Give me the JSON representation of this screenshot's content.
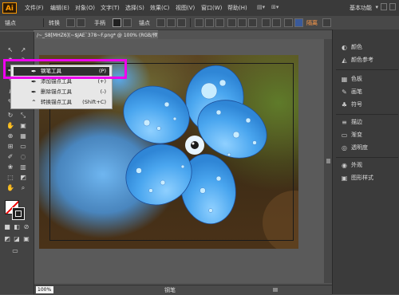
{
  "app": {
    "logo": "Ai"
  },
  "menubar": {
    "items": [
      "文件(F)",
      "编辑(E)",
      "对象(O)",
      "文字(T)",
      "选择(S)",
      "效果(C)",
      "视图(V)",
      "窗口(W)",
      "帮助(H)"
    ],
    "workspace": "基本功能"
  },
  "controlbar": {
    "anchor_label": "锚点",
    "convert_label": "转换",
    "handle_label": "手柄",
    "anchors_label": "锚点",
    "isolate_label": "隔离"
  },
  "document": {
    "tab_title": "/~_S8[MHZ6](~$JAE`378~F.png* @ 100% (RGB/预览)",
    "zoom": "100%",
    "status_tool": "钢笔"
  },
  "flyout": {
    "items": [
      {
        "icon": "pen-icon",
        "label": "钢笔工具",
        "shortcut": "(P)",
        "selected": true
      },
      {
        "icon": "add-anchor-icon",
        "label": "添加锚点工具",
        "shortcut": "(+)",
        "selected": false
      },
      {
        "icon": "delete-anchor-icon",
        "label": "删除锚点工具",
        "shortcut": "(-)",
        "selected": false
      },
      {
        "icon": "convert-anchor-icon",
        "label": "转换锚点工具",
        "shortcut": "(Shift+C)",
        "selected": false
      }
    ]
  },
  "right_panel": {
    "items": [
      {
        "icon": "color-icon",
        "label": "颜色"
      },
      {
        "icon": "color-guide-icon",
        "label": "颜色参考"
      },
      {
        "icon": "swatches-icon",
        "label": "色板"
      },
      {
        "icon": "brushes-icon",
        "label": "画笔"
      },
      {
        "icon": "symbols-icon",
        "label": "符号"
      },
      {
        "icon": "stroke-icon",
        "label": "描边"
      },
      {
        "icon": "gradient-icon",
        "label": "渐变"
      },
      {
        "icon": "transparency-icon",
        "label": "透明度"
      },
      {
        "icon": "appearance-icon",
        "label": "外观"
      },
      {
        "icon": "graphic-styles-icon",
        "label": "图形样式"
      }
    ]
  },
  "colors": {
    "flower_blue": "#4aa6ef",
    "highlight": "#ee00ee",
    "accent": "#ff9a00"
  }
}
